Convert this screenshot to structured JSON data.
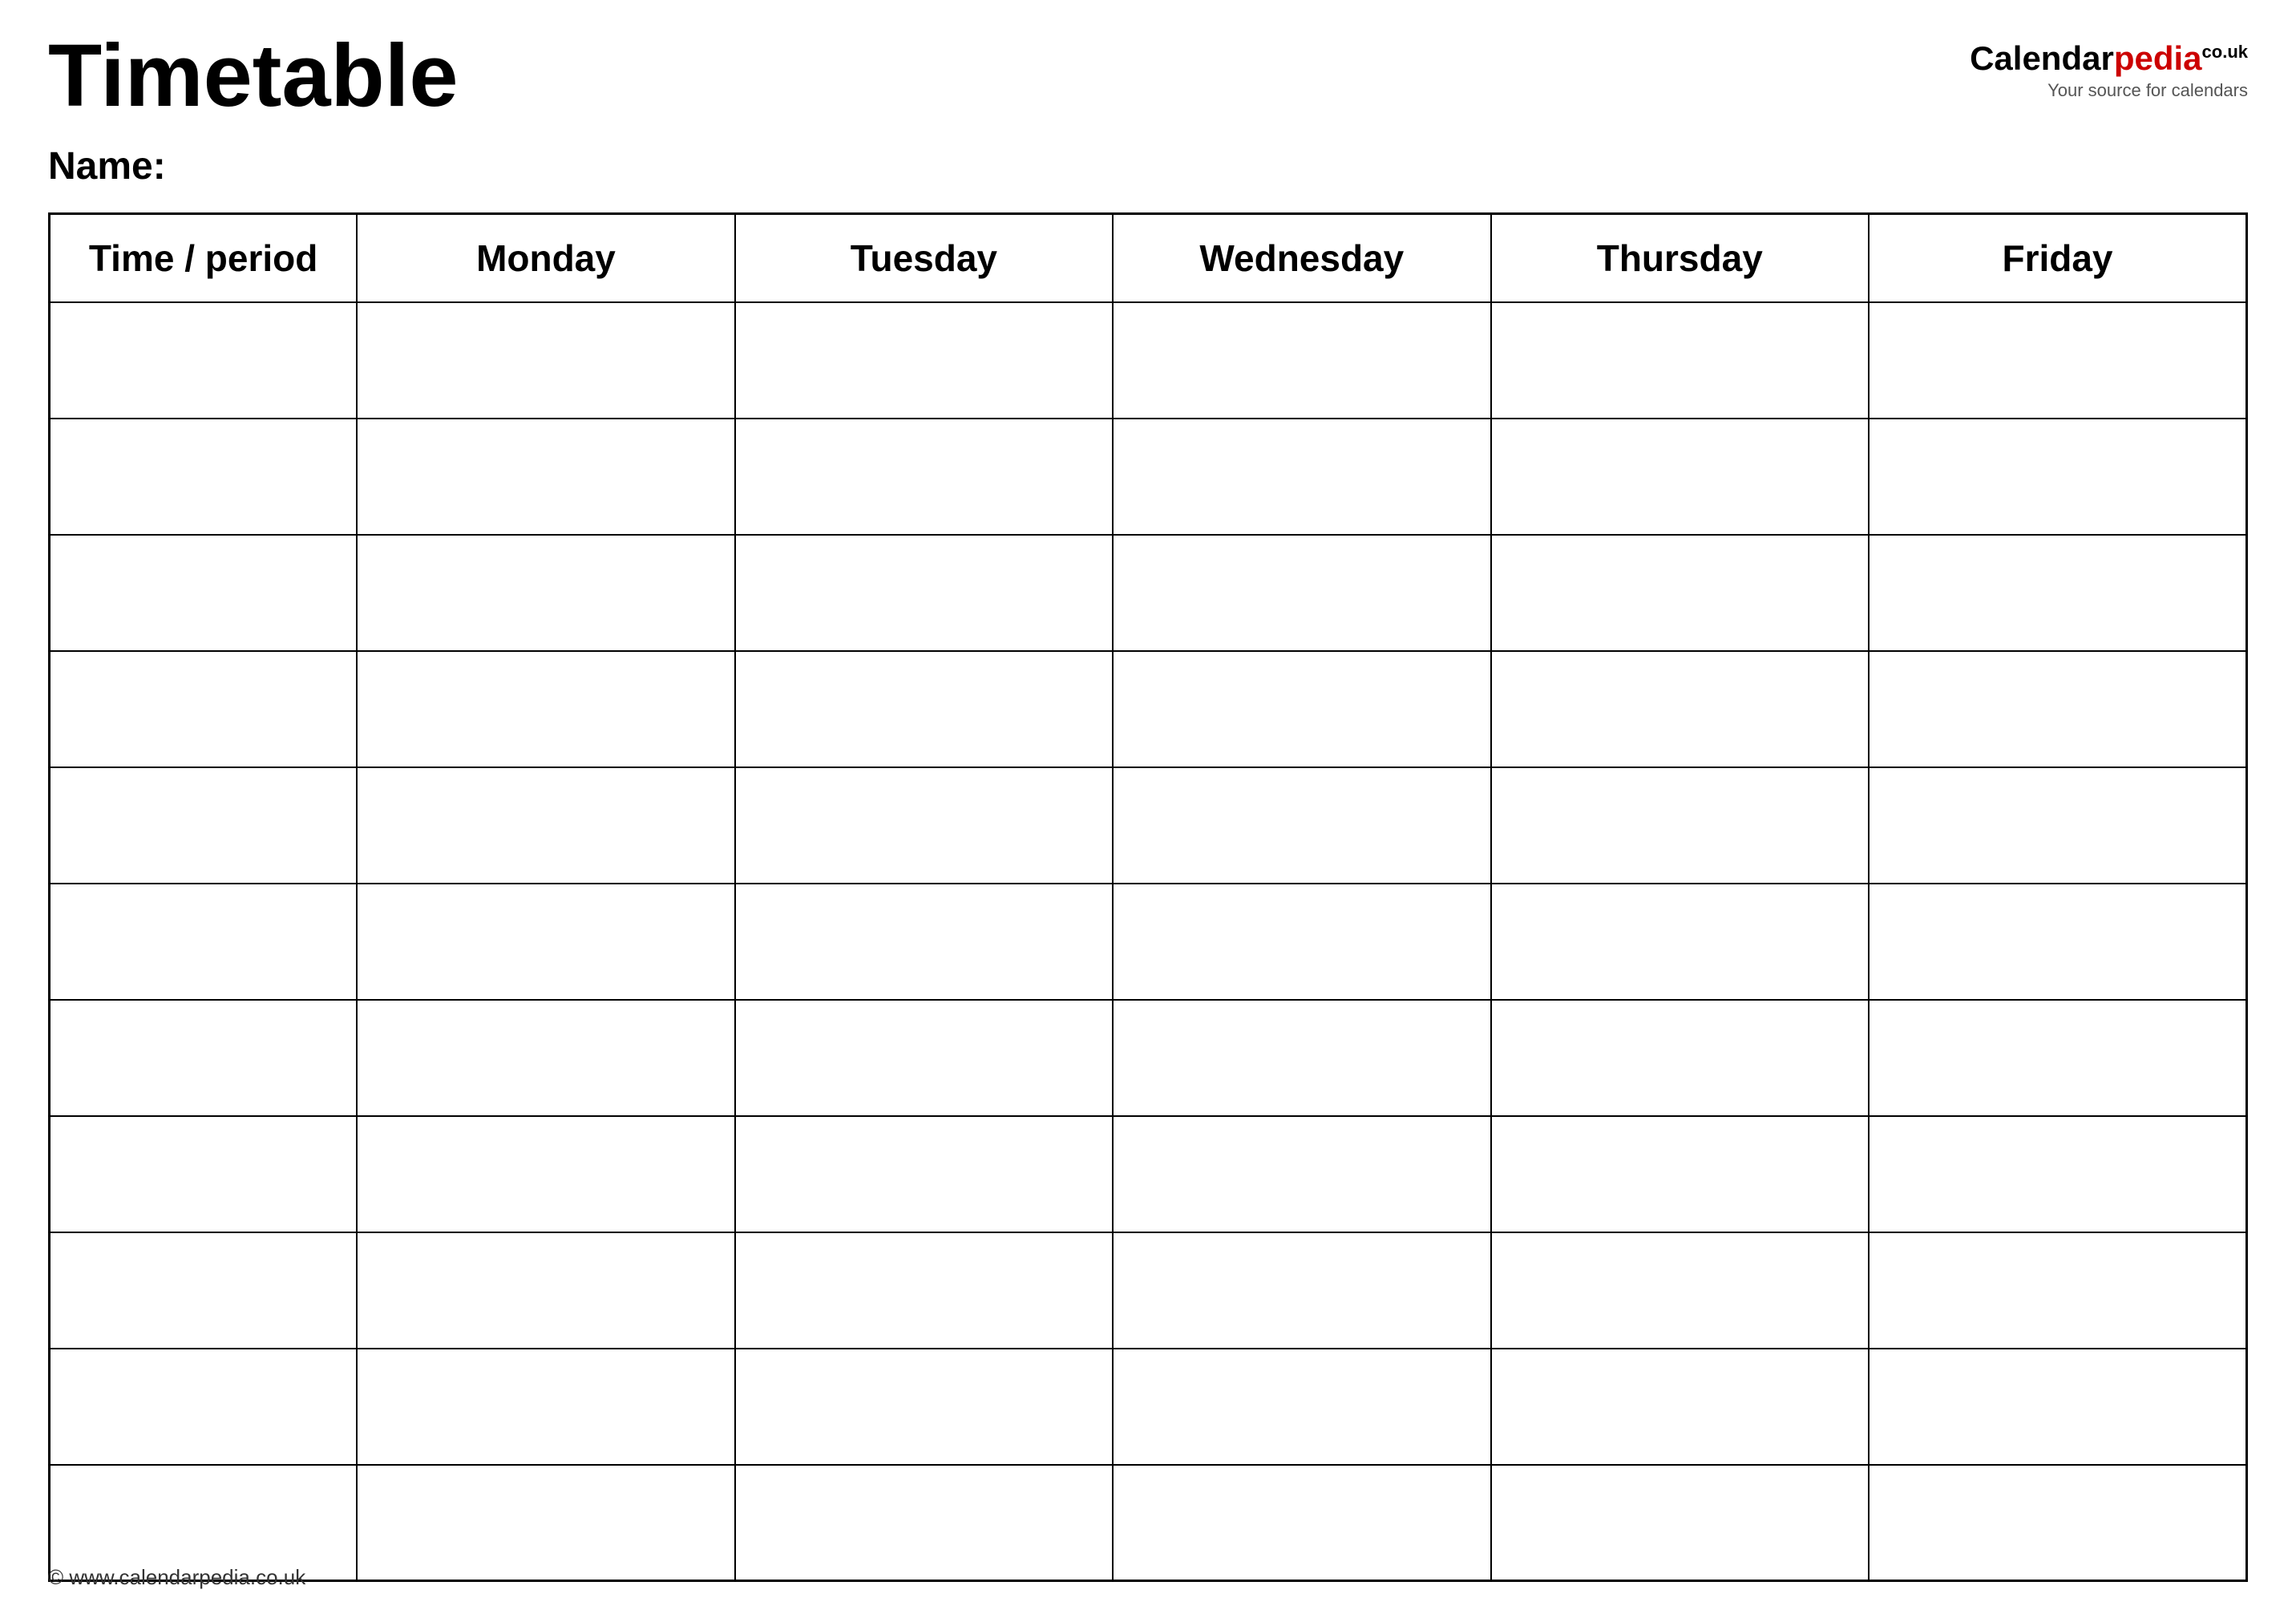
{
  "header": {
    "title": "Timetable",
    "logo": {
      "calendar": "Calendar",
      "pedia": "pedia",
      "co_uk": "co.uk",
      "tagline": "Your source for calendars"
    }
  },
  "name_label": "Name:",
  "table": {
    "columns": [
      "Time / period",
      "Monday",
      "Tuesday",
      "Wednesday",
      "Thursday",
      "Friday"
    ],
    "row_count": 11
  },
  "footer": {
    "url": "© www.calendarpedia.co.uk"
  }
}
